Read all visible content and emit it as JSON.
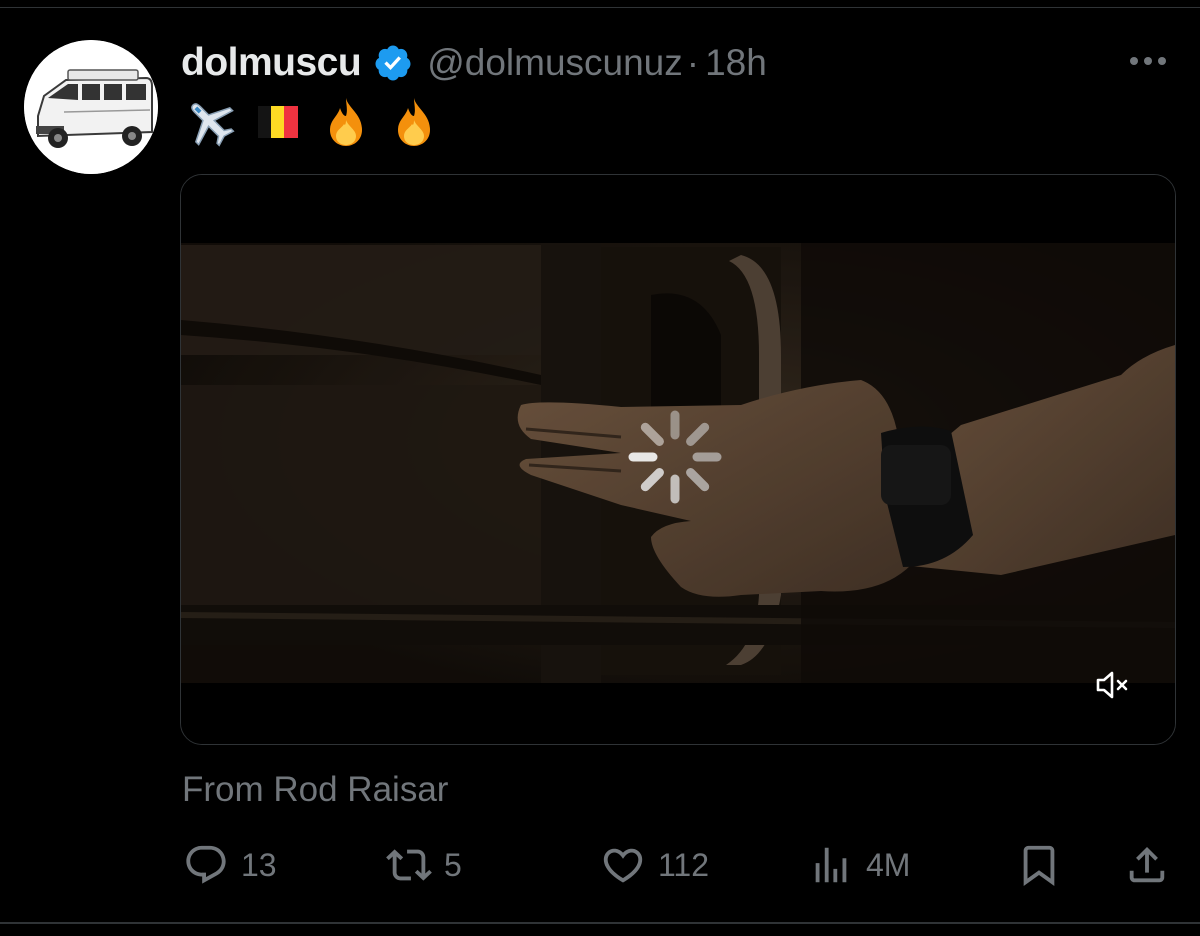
{
  "tweet": {
    "display_name": "dolmuscu",
    "handle": "@dolmuscunuz",
    "separator": "·",
    "time": "18h",
    "emojis": [
      "airplane-icon",
      "belgium-flag-icon",
      "fire-icon",
      "fire-icon"
    ],
    "source": "From Rod Raisar"
  },
  "media": {
    "type": "video",
    "state": "loading",
    "muted": true
  },
  "actions": {
    "replies": "13",
    "reposts": "5",
    "likes": "112",
    "views": "4M"
  },
  "colors": {
    "background": "#000000",
    "text_primary": "#e7e9ea",
    "text_secondary": "#71767b",
    "verified_badge": "#1d9bf0",
    "border": "#2f3336"
  }
}
